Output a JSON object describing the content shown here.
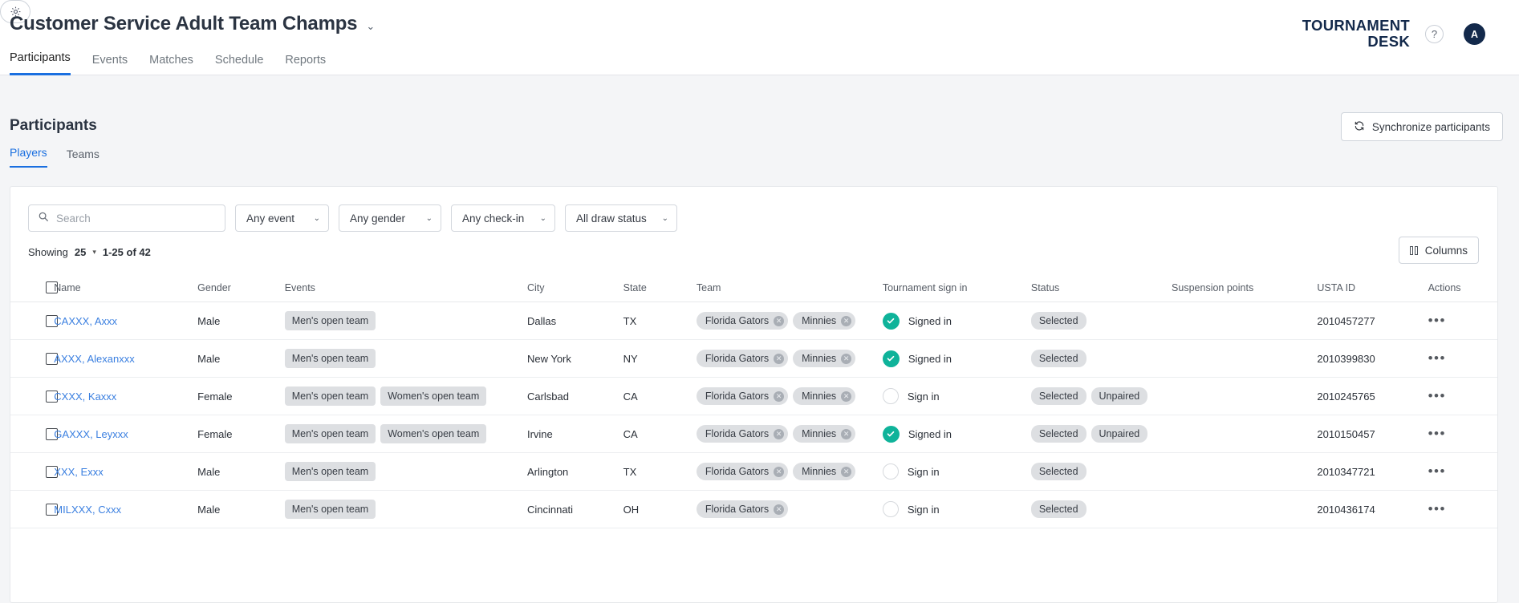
{
  "topbar": {
    "tournament_title": "Customer Service Adult Team Champs",
    "title_caret": "⌄",
    "gear_icon": "gear-icon",
    "nav": [
      {
        "label": "Participants",
        "active": true
      },
      {
        "label": "Events",
        "active": false
      },
      {
        "label": "Matches",
        "active": false
      },
      {
        "label": "Schedule",
        "active": false
      },
      {
        "label": "Reports",
        "active": false
      }
    ],
    "brand_line1": "TOURNAMENT",
    "brand_line2": "DESK",
    "help_label": "?",
    "avatar_initial": "A"
  },
  "page": {
    "title": "Participants",
    "sync_button": "Synchronize participants",
    "sync_icon": "refresh-icon",
    "sub_tabs": [
      {
        "label": "Players",
        "active": true
      },
      {
        "label": "Teams",
        "active": false
      }
    ]
  },
  "filters": {
    "search_placeholder": "Search",
    "search_value": "",
    "search_icon": "search-icon",
    "event_filter": "Any event",
    "gender_filter": "Any gender",
    "checkin_filter": "Any check-in",
    "draw_filter": "All draw status",
    "caret": "⌄"
  },
  "showing": {
    "label": "Showing",
    "page_size": "25",
    "caret": "▾",
    "range": "1-25 of 42"
  },
  "columns_button": {
    "label": "Columns",
    "icon": "columns-icon"
  },
  "table": {
    "headers": [
      "Name",
      "Gender",
      "Events",
      "City",
      "State",
      "Team",
      "Tournament sign in",
      "Status",
      "Suspension points",
      "USTA ID",
      "Actions"
    ],
    "actions_glyph": "•••",
    "rows": [
      {
        "name": "CAXXX, Axxx",
        "gender": "Male",
        "events": [
          "Men's open team"
        ],
        "city": "Dallas",
        "state": "TX",
        "teams": [
          "Florida Gators",
          "Minnies"
        ],
        "signin_state": "signed-in",
        "signin_label": "Signed in",
        "status": [
          "Selected"
        ],
        "suspension_points": "",
        "usta_id": "2010457277"
      },
      {
        "name": "AXXX, Alexanxxx",
        "gender": "Male",
        "events": [
          "Men's open team"
        ],
        "city": "New York",
        "state": "NY",
        "teams": [
          "Florida Gators",
          "Minnies"
        ],
        "signin_state": "signed-in",
        "signin_label": "Signed in",
        "status": [
          "Selected"
        ],
        "suspension_points": "",
        "usta_id": "2010399830"
      },
      {
        "name": "CXXX, Kaxxx",
        "gender": "Female",
        "events": [
          "Men's open team",
          "Women's open team"
        ],
        "city": "Carlsbad",
        "state": "CA",
        "teams": [
          "Florida Gators",
          "Minnies"
        ],
        "signin_state": "sign-in",
        "signin_label": "Sign in",
        "status": [
          "Selected",
          "Unpaired"
        ],
        "suspension_points": "",
        "usta_id": "2010245765"
      },
      {
        "name": "GAXXX, Leyxxx",
        "gender": "Female",
        "events": [
          "Men's open team",
          "Women's open team"
        ],
        "city": "Irvine",
        "state": "CA",
        "teams": [
          "Florida Gators",
          "Minnies"
        ],
        "signin_state": "signed-in",
        "signin_label": "Signed in",
        "status": [
          "Selected",
          "Unpaired"
        ],
        "suspension_points": "",
        "usta_id": "2010150457"
      },
      {
        "name": "XXX, Exxx",
        "gender": "Male",
        "events": [
          "Men's open team"
        ],
        "city": "Arlington",
        "state": "TX",
        "teams": [
          "Florida Gators",
          "Minnies"
        ],
        "signin_state": "sign-in",
        "signin_label": "Sign in",
        "status": [
          "Selected"
        ],
        "suspension_points": "",
        "usta_id": "2010347721"
      },
      {
        "name": "MILXXX, Cxxx",
        "gender": "Male",
        "events": [
          "Men's open team"
        ],
        "city": "Cincinnati",
        "state": "OH",
        "teams": [
          "Florida Gators"
        ],
        "signin_state": "sign-in",
        "signin_label": "Sign in",
        "status": [
          "Selected"
        ],
        "suspension_points": "",
        "usta_id": "2010436174"
      }
    ]
  },
  "colors": {
    "accent_blue": "#1a6fe0",
    "link_blue": "#3a7fe0",
    "brand_navy": "#13294b",
    "signed_in_green": "#0fb39a",
    "chip_gray": "#dddfe2",
    "page_bg": "#f4f5f7"
  }
}
